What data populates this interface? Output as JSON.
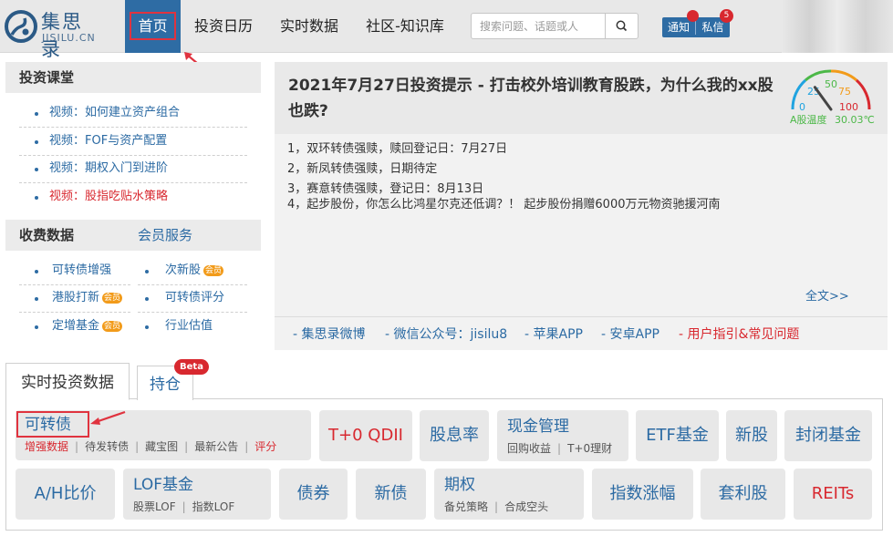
{
  "header": {
    "logo": {
      "name": "集思录",
      "sub": "JISILU.CN"
    },
    "nav": [
      "首页",
      "投资日历",
      "实时数据",
      "社区-知识库"
    ],
    "search": {
      "placeholder": "搜索问题、话题或人"
    },
    "notify_label": "通知",
    "message_label": "私信",
    "message_badge": "5"
  },
  "sidebar": {
    "course_title": "投资课堂",
    "courses": [
      "视频：如何建立资产组合",
      "视频：FOF与资产配置",
      "视频：期权入门到进阶",
      "视频：股指吃贴水策略"
    ],
    "fee_title": "收费数据",
    "member_link": "会员服务",
    "data_links": [
      {
        "label": "可转债增强",
        "vip": false
      },
      {
        "label": "次新股",
        "vip": true
      },
      {
        "label": "港股打新",
        "vip": true
      },
      {
        "label": "可转债评分",
        "vip": false
      },
      {
        "label": "定增基金",
        "vip": true
      },
      {
        "label": "行业估值",
        "vip": false
      }
    ],
    "vip_label": "会员"
  },
  "news": {
    "title": "2021年7月27日投资提示 - 打击校外培训教育股跌，为什么我的xx股也跌?",
    "items": [
      "1，双环转债强赎，赎回登记日：7月27日",
      "2，新凤转债强赎，日期待定",
      "3，赛意转债强赎，登记日：8月13日",
      "4，起步股份，你怎么比鸿星尔克还低调？！ 起步股份捐赠6000万元物资驰援河南"
    ],
    "more": "全文>>",
    "links": [
      "- 集思录微博",
      "- 微信公众号：jisilu8",
      "- 苹果APP",
      "- 安卓APP",
      "- 用户指引&常见问题"
    ]
  },
  "gauge": {
    "ticks": [
      "0",
      "25",
      "50",
      "75",
      "100"
    ],
    "caption": "A股温度",
    "value": "30.03℃",
    "value_num": 30.03,
    "colors": [
      "#1fa3e0",
      "#4cb848",
      "#f29b1a",
      "#d8282f"
    ]
  },
  "tabs": {
    "realtime": "实时投资数据",
    "holding": "持仓",
    "beta": "Beta"
  },
  "tiles": {
    "kzz": {
      "label": "可转债",
      "subs": [
        "增强数据",
        "待发转债",
        "藏宝图",
        "最新公告",
        "评分"
      ]
    },
    "t0qdii": "T+0 QDII",
    "dividend": "股息率",
    "cash": {
      "label": "现金管理",
      "subs": [
        "回购收益",
        "T+0理财"
      ]
    },
    "etf": "ETF基金",
    "ipo": "新股",
    "closed": "封闭基金",
    "ah": "A/H比价",
    "lof": {
      "label": "LOF基金",
      "subs": [
        "股票LOF",
        "指数LOF"
      ]
    },
    "bond": "债券",
    "newbond": "新债",
    "option": {
      "label": "期权",
      "subs": [
        "备兑策略",
        "合成空头"
      ]
    },
    "index": "指数涨幅",
    "arbitrage": "套利股",
    "reits": "REITs"
  },
  "colors": {
    "accent": "#2e6ca4",
    "link": "#2b6aa3",
    "alert": "#d8282f",
    "vip": "#f29b1a"
  }
}
